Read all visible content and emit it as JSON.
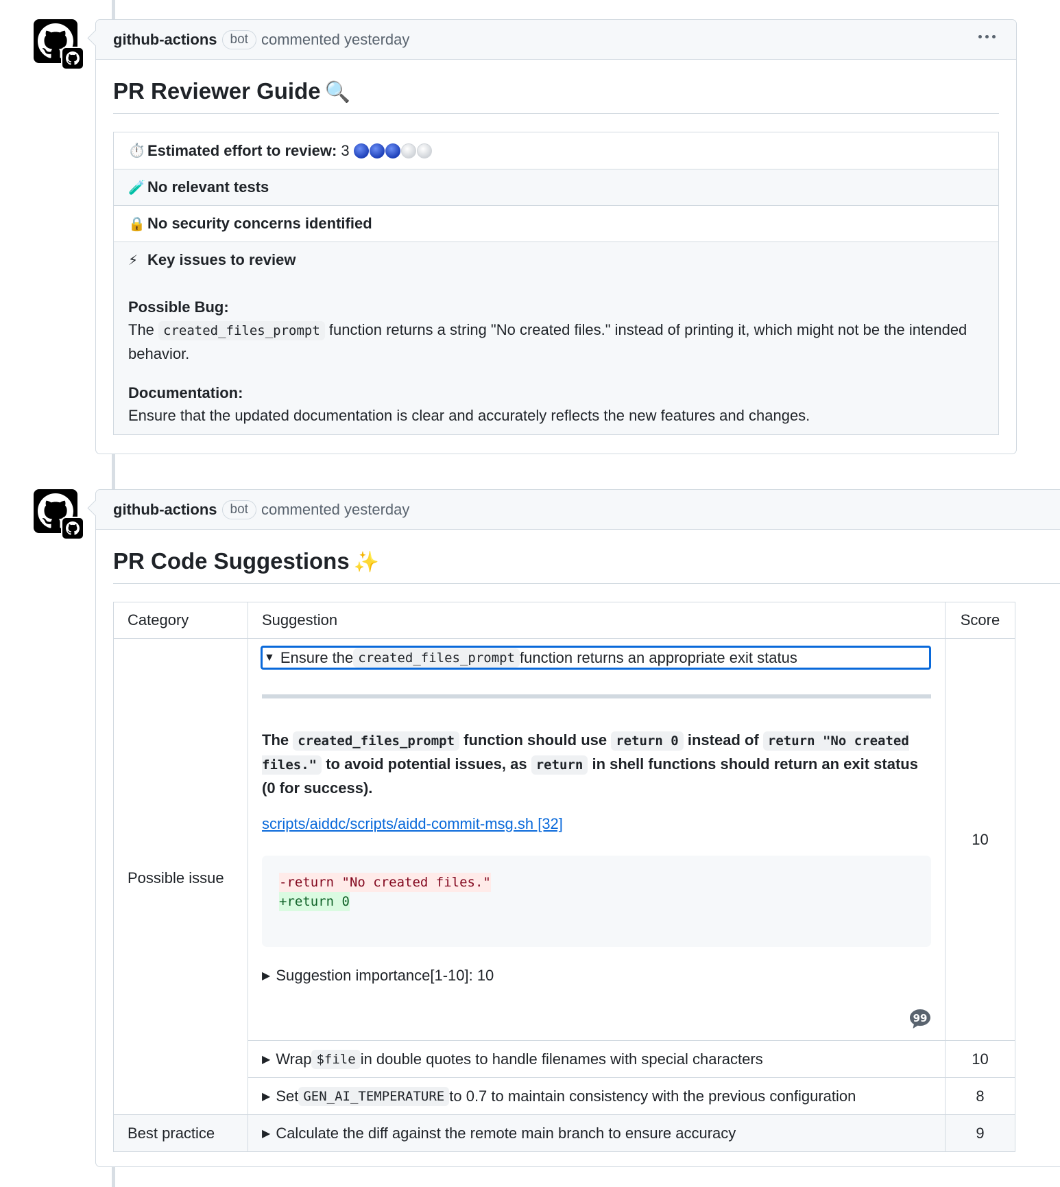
{
  "comments": [
    {
      "author": "github-actions",
      "badge": "bot",
      "meta": "commented yesterday"
    },
    {
      "author": "github-actions",
      "badge": "bot",
      "meta": "commented yesterday"
    }
  ],
  "reviewer_guide": {
    "title": "PR Reviewer Guide",
    "title_emoji": "🔍",
    "effort": {
      "icon": "stopwatch-icon",
      "emoji": "⏱️",
      "label": "Estimated effort to review:",
      "value": "3",
      "max": 5
    },
    "tests": {
      "icon": "test-tube-icon",
      "emoji": "🧪",
      "label": "No relevant tests"
    },
    "security": {
      "icon": "lock-icon",
      "emoji": "🔒",
      "label": "No security concerns identified"
    },
    "key_issues": {
      "icon": "lightning-icon",
      "emoji": "⚡",
      "label": "Key issues to review",
      "bug_label": "Possible Bug:",
      "bug_pre": "The ",
      "bug_code": "created_files_prompt",
      "bug_post": " function returns a string \"No created files.\" instead of printing it, which might not be the intended behavior.",
      "doc_label": "Documentation:",
      "doc_text": "Ensure that the updated documentation is clear and accurately reflects the new features and changes."
    }
  },
  "code_suggestions": {
    "title": "PR Code Suggestions",
    "title_emoji": "✨",
    "headers": {
      "category": "Category",
      "suggestion": "Suggestion",
      "score": "Score"
    },
    "categories": {
      "possible_issue": "Possible issue",
      "best_practice": "Best practice"
    },
    "expanded": {
      "summary_pre": "Ensure the ",
      "summary_code": "created_files_prompt",
      "summary_post": " function returns an appropriate exit status",
      "desc_1": "The ",
      "desc_code_1": "created_files_prompt",
      "desc_2": " function should use ",
      "desc_code_2": "return 0",
      "desc_3": " instead of ",
      "desc_code_3": "return \"No created files.\"",
      "desc_4": " to avoid potential issues, as ",
      "desc_code_4": "return",
      "desc_5": " in shell functions should return an exit status (0 for success).",
      "link": "scripts/aiddc/scripts/aidd-commit-msg.sh [32]",
      "diff_removed": "-return \"No created files.\"",
      "diff_added": "+return 0",
      "importance": "Suggestion importance[1-10]: 10",
      "score": "10"
    },
    "rows": [
      {
        "pre": "Wrap ",
        "code": "$file",
        "post": " in double quotes to handle filenames with special characters",
        "score": "10"
      },
      {
        "pre": "Set ",
        "code": "GEN_AI_TEMPERATURE",
        "post": " to 0.7 to maintain consistency with the previous configuration",
        "score": "8"
      },
      {
        "pre": "",
        "code": "",
        "post": "Calculate the diff against the remote main branch to ensure accuracy",
        "score": "9"
      }
    ]
  }
}
